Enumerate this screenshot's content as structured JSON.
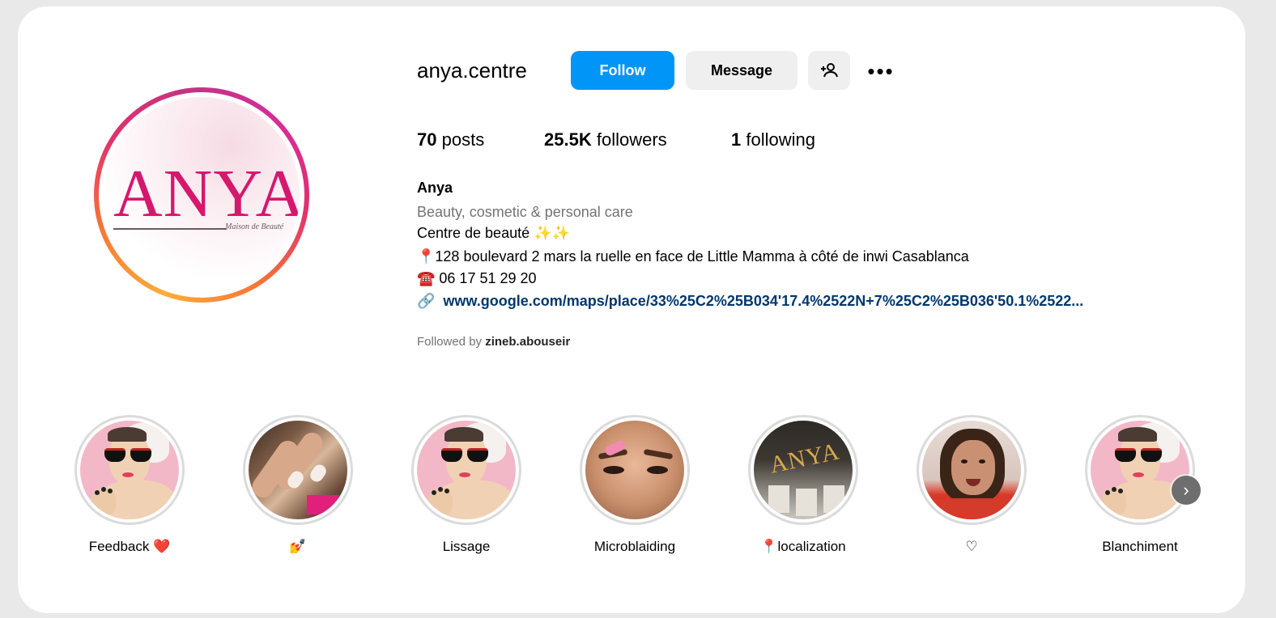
{
  "profile": {
    "username": "anya.centre",
    "avatar_logo_text": "ANYA",
    "avatar_logo_sub": "Maison de Beauté"
  },
  "actions": {
    "follow_label": "Follow",
    "message_label": "Message",
    "suggest_icon": "person-plus-icon",
    "more_icon": "more-options-icon",
    "more_glyph": "•••"
  },
  "stats": {
    "posts_count": "70",
    "posts_label": "posts",
    "followers_count": "25.5K",
    "followers_label": "followers",
    "following_count": "1",
    "following_label": "following"
  },
  "bio": {
    "name": "Anya",
    "category": "Beauty, cosmetic & personal care",
    "line1": "Centre de beauté ✨✨",
    "line2": "📍128 boulevard 2 mars la ruelle en face de Little Mamma à côté de inwi Casablanca",
    "line3": "☎️ 06 17 51 29 20",
    "link": "www.google.com/maps/place/33%25C2%25B034'17.4%2522N+7%25C2%25B036'50.1%2522...",
    "link_icon": "🔗",
    "followed_by_prefix": "Followed by",
    "followed_by_user": "zineb.abouseir"
  },
  "highlights": [
    {
      "label": "Feedback ❤️",
      "cover": "illustrated-woman"
    },
    {
      "label": "💅",
      "cover": "nails-photo"
    },
    {
      "label": "Lissage",
      "cover": "illustrated-woman"
    },
    {
      "label": "Microblaiding",
      "cover": "eyebrow-photo"
    },
    {
      "label": "📍localization",
      "cover": "storefront-photo"
    },
    {
      "label": "♡",
      "cover": "woman-photo"
    },
    {
      "label": "Blanchiment",
      "cover": "illustrated-woman"
    }
  ],
  "highlight_cover_sign": "ANYA",
  "next_icon": "chevron-right-icon",
  "next_glyph": "›",
  "colors": {
    "follow_button": "#0095f6",
    "secondary_button": "#efefef",
    "link": "#00376b",
    "muted_text": "#737373",
    "logo_pink": "#d5186e"
  }
}
